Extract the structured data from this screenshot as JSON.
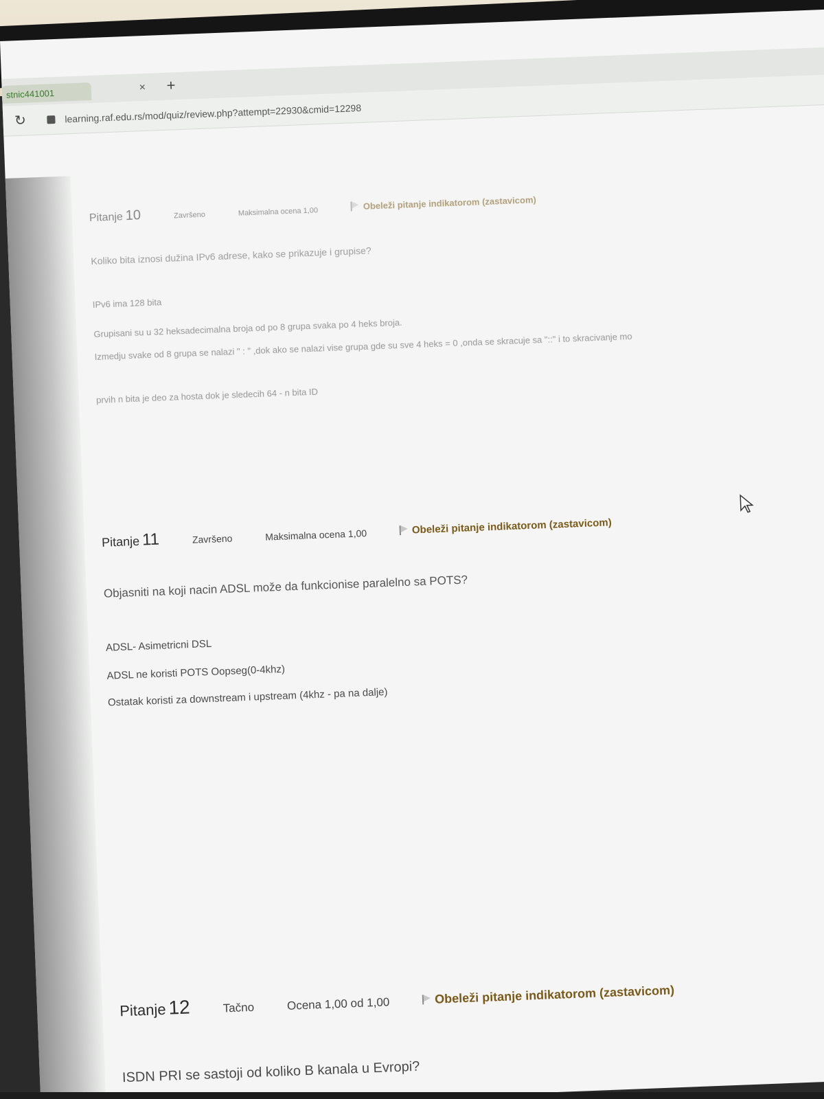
{
  "browser": {
    "tab_label": "stnic441001",
    "url": "learning.raf.edu.rs/mod/quiz/review.php?attempt=22930&cmid=12298"
  },
  "questions": [
    {
      "label": "Pitanje",
      "number": "10",
      "state": "Završeno",
      "grade": "Maksimalna ocena 1,00",
      "flag": "Obeleži pitanje indikatorom (zastavicom)",
      "text": "Koliko bita iznosi dužina IPv6 adrese, kako se prikazuje i grupise?",
      "answer": [
        "IPv6 ima 128 bita",
        "Grupisani su u 32 heksadecimalna broja od po 8 grupa svaka po 4 heks broja.",
        "Izmedju svake od 8 grupa se nalazi \" : \" ,dok ako se nalazi vise grupa gde su sve 4 heks = 0 ,onda se skracuje sa \"::\" i to skracivanje mo",
        "prvih n bita je deo za hosta dok je sledecih 64 - n bita ID"
      ]
    },
    {
      "label": "Pitanje",
      "number": "11",
      "state": "Završeno",
      "grade": "Maksimalna ocena 1,00",
      "flag": "Obeleži pitanje indikatorom (zastavicom)",
      "text": "Objasniti na koji nacin ADSL može da funkcionise paralelno sa POTS?",
      "answer": [
        "ADSL- Asimetricni DSL",
        "ADSL ne koristi POTS Oopseg(0-4khz)",
        "Ostatak koristi za downstream i upstream (4khz - pa na dalje)"
      ]
    },
    {
      "label": "Pitanje",
      "number": "12",
      "state": "Tačno",
      "grade": "Ocena 1,00 od 1,00",
      "flag": "Obeleži pitanje indikatorom (zastavicom)",
      "text": "ISDN PRI se sastoji od koliko B kanala u Evropi?"
    }
  ]
}
